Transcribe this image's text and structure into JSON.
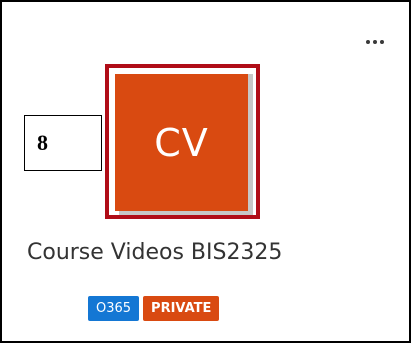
{
  "card": {
    "title": "Course Videos BIS2325",
    "initials": "CV",
    "tile_color": "#d94a11",
    "more_icon": "more-horizontal-icon",
    "badges": [
      {
        "label": "O365",
        "color": "#1477d4"
      },
      {
        "label": "PRIVATE",
        "color": "#d94a11"
      }
    ]
  },
  "annotation": {
    "number": "8",
    "highlight_color": "#b00d17"
  }
}
